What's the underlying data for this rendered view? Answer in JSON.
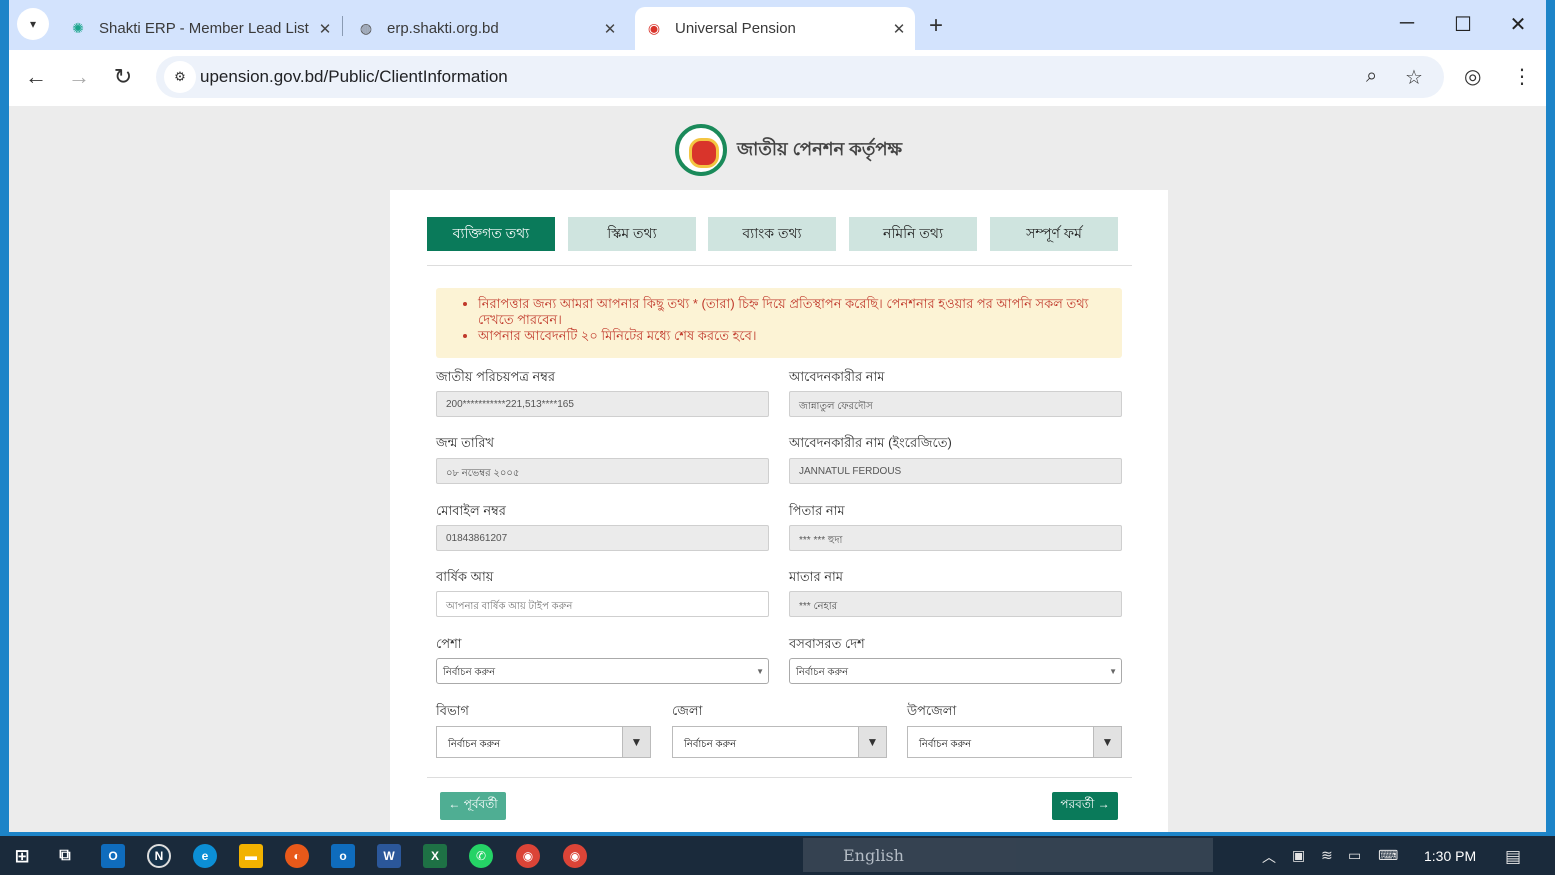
{
  "browser": {
    "tabs": [
      {
        "title": "Shakti ERP - Member Lead List",
        "icon": "shakti-icon"
      },
      {
        "title": "erp.shakti.org.bd",
        "icon": "globe-icon"
      },
      {
        "title": "Universal Pension",
        "icon": "pension-logo-icon"
      }
    ],
    "url": "upension.gov.bd/Public/ClientInformation"
  },
  "page": {
    "org_name": "জাতীয় পেনশন কর্তৃপক্ষ",
    "steps": [
      "ব্যক্তিগত তথ্য",
      "স্কিম তথ্য",
      "ব্যাংক তথ্য",
      "নমিনি তথ্য",
      "সম্পূর্ণ ফর্ম"
    ],
    "active_step": 0,
    "alerts": [
      "নিরাপত্তার জন্য আমরা আপনার কিছু তথ্য * (তারা) চিহ্ন দিয়ে প্রতিস্থাপন করেছি। পেনশনার হওয়ার পর আপনি সকল তথ্য দেখতে পারবেন।",
      "আপনার আবেদনটি ২০ মিনিটের মধ্যে শেষ করতে হবে।"
    ],
    "fields": {
      "nid": {
        "label": "জাতীয় পরিচয়পত্র নম্বর",
        "value": "200***********221,513****165"
      },
      "applicant_name": {
        "label": "আবেদনকারীর নাম",
        "value": "জান্নাতুল ফেরদৌস"
      },
      "dob": {
        "label": "জন্ম তারিখ",
        "value": "০৮ নভেম্বর ২০০৫"
      },
      "applicant_name_en": {
        "label": "আবেদনকারীর নাম (ইংরেজিতে)",
        "value": "JANNATUL FERDOUS"
      },
      "mobile": {
        "label": "মোবাইল নম্বর",
        "value": "01843861207"
      },
      "father_name": {
        "label": "পিতার নাম",
        "value": "*** *** হুদা"
      },
      "annual_income": {
        "label": "বার্ষিক আয়",
        "placeholder": "আপনার বার্ষিক আয় টাইপ করুন"
      },
      "mother_name": {
        "label": "মাতার নাম",
        "value": "*** নেহার"
      },
      "occupation": {
        "label": "পেশা",
        "value": "নির্বাচন করুন"
      },
      "country": {
        "label": "বসবাসরত দেশ",
        "value": "নির্বাচন করুন"
      },
      "division": {
        "label": "বিভাগ",
        "value": "নির্বাচন করুন"
      },
      "district": {
        "label": "জেলা",
        "value": "নির্বাচন করুন"
      },
      "upazila": {
        "label": "উপজেলা",
        "value": "নির্বাচন করুন"
      }
    },
    "prev_label": "← পূর্ববর্তী",
    "next_label": "পরবর্তী →"
  },
  "taskbar": {
    "language": "English",
    "clock": "1:30 PM"
  },
  "colors": {
    "primary_green": "#0a7a5a",
    "alert_bg": "#fcf3d5",
    "alert_text": "#c0392b"
  }
}
